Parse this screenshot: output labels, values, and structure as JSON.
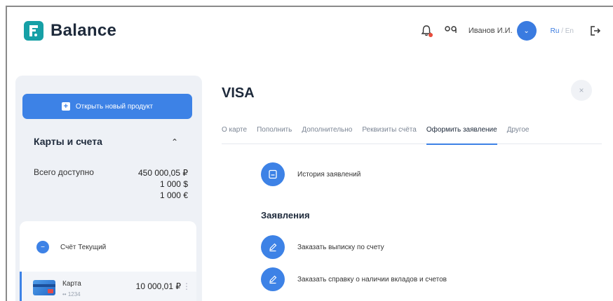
{
  "header": {
    "brand": "Balance",
    "user_name": "Иванов И.И.",
    "lang_ru": "Ru",
    "lang_sep": " / ",
    "lang_en": "En"
  },
  "sidebar": {
    "new_product_button": "Открыть новый продукт",
    "section_title": "Карты и счета",
    "available_label": "Всего доступно",
    "available_values": [
      "450 000,05 ₽",
      "1 000 $",
      "1 000 €"
    ],
    "account_name": "Счёт Текущий",
    "card": {
      "name": "Карта",
      "number": "•• 1234",
      "amount": "10 000,01 ₽"
    }
  },
  "main": {
    "title": "VISA",
    "tabs": [
      {
        "label": "О карте"
      },
      {
        "label": "Пополнить"
      },
      {
        "label": "Дополнительно"
      },
      {
        "label": "Реквизиты счёта"
      },
      {
        "label": "Оформить заявление"
      },
      {
        "label": "Другое"
      }
    ],
    "active_tab": "Оформить заявление",
    "history_label": "История заявлений",
    "section_heading": "Заявления",
    "applications": [
      {
        "label": "Заказать выписку по счету"
      },
      {
        "label": "Заказать справку о наличии вкладов и счетов"
      }
    ]
  },
  "colors": {
    "accent": "#3d82e6",
    "brand": "#16a0a6",
    "sidebar_bg": "#eef1f6"
  },
  "icons": {
    "bell": "bell-icon",
    "glasses": "low-vision-icon",
    "logout": "logout-icon",
    "history": "document-icon",
    "application": "pencil-icon"
  }
}
